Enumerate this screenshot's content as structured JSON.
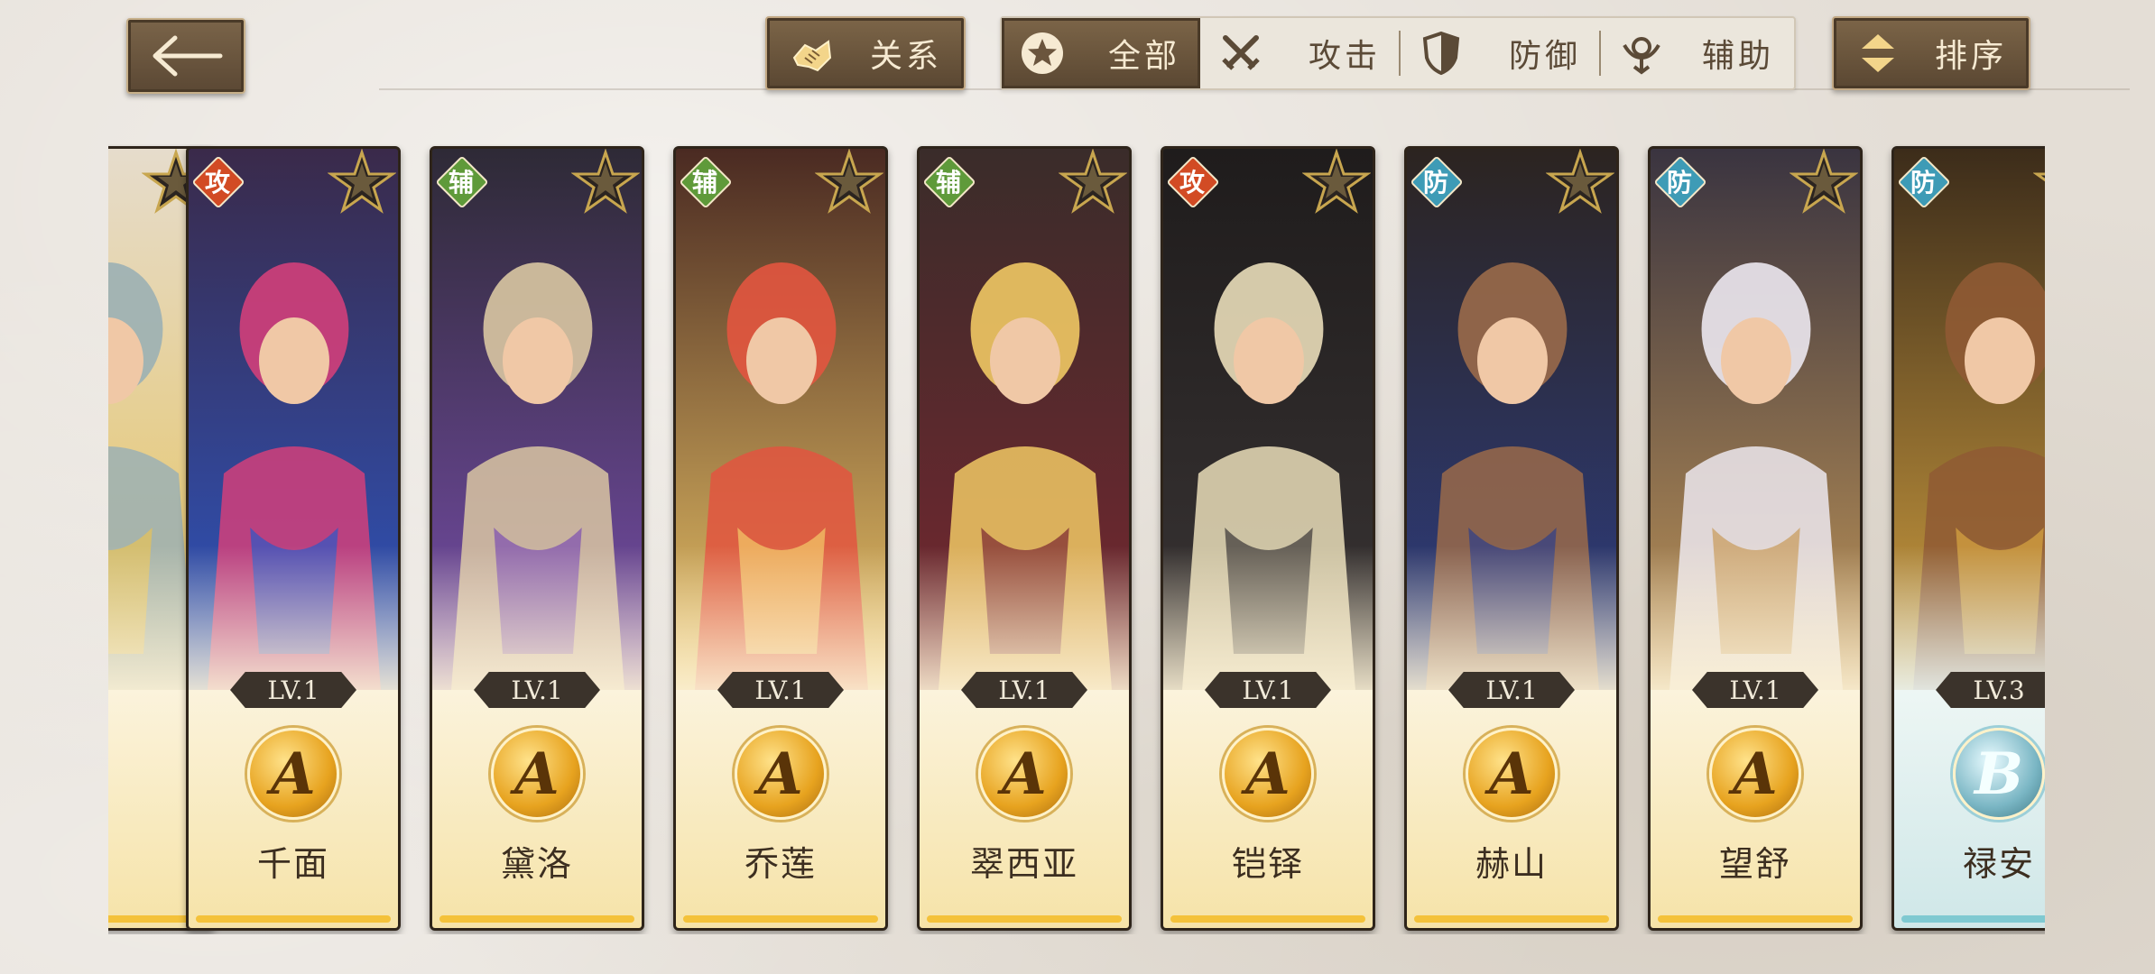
{
  "toolbar": {
    "relation_label": "关系",
    "sort_label": "排序",
    "tabs": [
      {
        "label": "全部",
        "icon": "star-circle-icon",
        "active": true
      },
      {
        "label": "攻击",
        "icon": "crossed-swords-icon",
        "active": false
      },
      {
        "label": "防御",
        "icon": "shield-icon",
        "active": false
      },
      {
        "label": "辅助",
        "icon": "support-icon",
        "active": false
      }
    ]
  },
  "cards": [
    {
      "name": "",
      "role": "",
      "level": "",
      "rank": "",
      "partial": true
    },
    {
      "name": "千面",
      "role": "攻",
      "level": "LV.1",
      "rank": "A"
    },
    {
      "name": "黛洛",
      "role": "辅",
      "level": "LV.1",
      "rank": "A"
    },
    {
      "name": "乔莲",
      "role": "辅",
      "level": "LV.1",
      "rank": "A"
    },
    {
      "name": "翠西亚",
      "role": "辅",
      "level": "LV.1",
      "rank": "A"
    },
    {
      "name": "铠铎",
      "role": "攻",
      "level": "LV.1",
      "rank": "A"
    },
    {
      "name": "赫山",
      "role": "防",
      "level": "LV.1",
      "rank": "A"
    },
    {
      "name": "望舒",
      "role": "防",
      "level": "LV.1",
      "rank": "A"
    },
    {
      "name": "禄安",
      "role": "防",
      "level": "LV.3",
      "rank": "B"
    }
  ],
  "colors": {
    "attack": "#d24b24",
    "support": "#5f9a3a",
    "defense": "#3e9bb6",
    "rank_a": "#e7a31f",
    "rank_b": "#7ab6c4",
    "button_brown": "#6b553d"
  }
}
